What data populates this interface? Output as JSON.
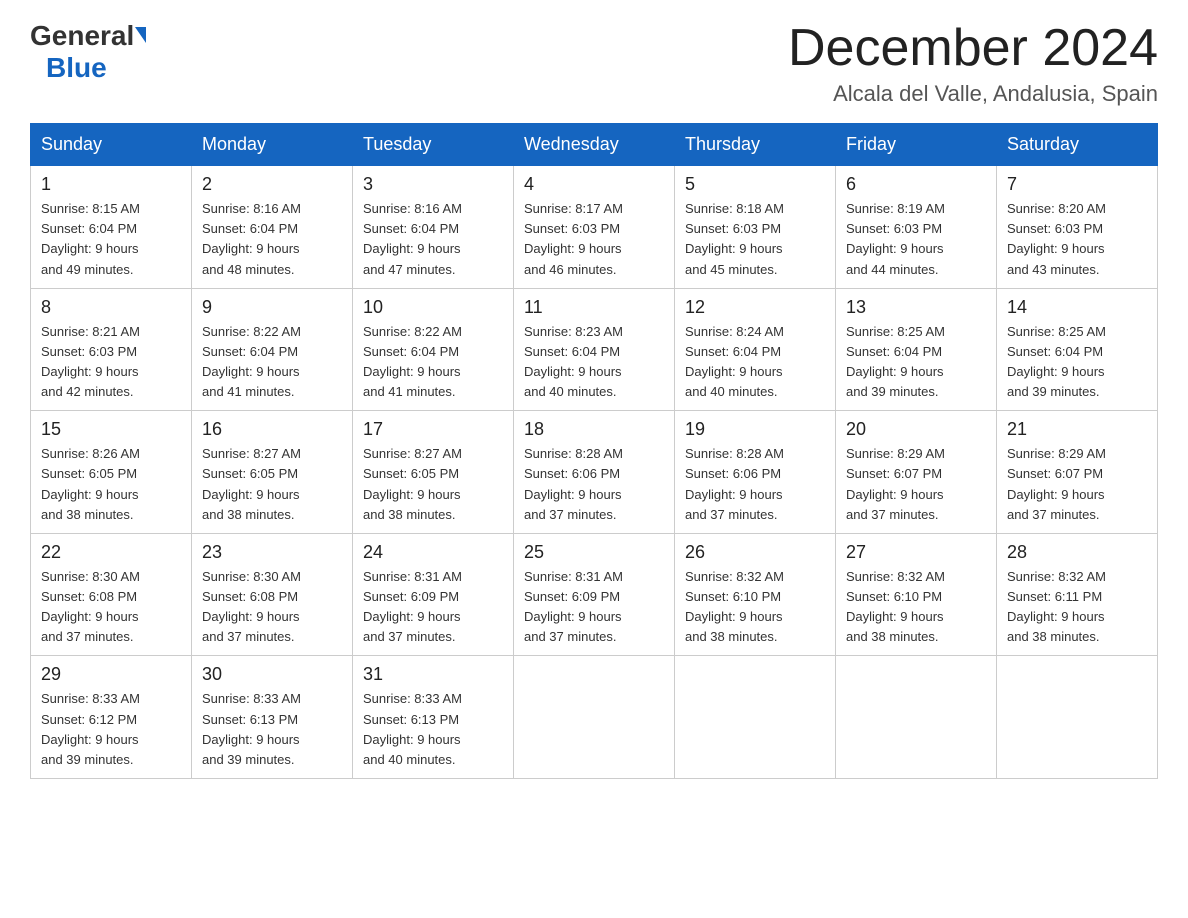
{
  "header": {
    "logo_general": "General",
    "logo_blue": "Blue",
    "month_year": "December 2024",
    "location": "Alcala del Valle, Andalusia, Spain"
  },
  "days_of_week": [
    "Sunday",
    "Monday",
    "Tuesday",
    "Wednesday",
    "Thursday",
    "Friday",
    "Saturday"
  ],
  "weeks": [
    [
      {
        "day": "1",
        "sunrise": "8:15 AM",
        "sunset": "6:04 PM",
        "daylight": "9 hours and 49 minutes."
      },
      {
        "day": "2",
        "sunrise": "8:16 AM",
        "sunset": "6:04 PM",
        "daylight": "9 hours and 48 minutes."
      },
      {
        "day": "3",
        "sunrise": "8:16 AM",
        "sunset": "6:04 PM",
        "daylight": "9 hours and 47 minutes."
      },
      {
        "day": "4",
        "sunrise": "8:17 AM",
        "sunset": "6:03 PM",
        "daylight": "9 hours and 46 minutes."
      },
      {
        "day": "5",
        "sunrise": "8:18 AM",
        "sunset": "6:03 PM",
        "daylight": "9 hours and 45 minutes."
      },
      {
        "day": "6",
        "sunrise": "8:19 AM",
        "sunset": "6:03 PM",
        "daylight": "9 hours and 44 minutes."
      },
      {
        "day": "7",
        "sunrise": "8:20 AM",
        "sunset": "6:03 PM",
        "daylight": "9 hours and 43 minutes."
      }
    ],
    [
      {
        "day": "8",
        "sunrise": "8:21 AM",
        "sunset": "6:03 PM",
        "daylight": "9 hours and 42 minutes."
      },
      {
        "day": "9",
        "sunrise": "8:22 AM",
        "sunset": "6:04 PM",
        "daylight": "9 hours and 41 minutes."
      },
      {
        "day": "10",
        "sunrise": "8:22 AM",
        "sunset": "6:04 PM",
        "daylight": "9 hours and 41 minutes."
      },
      {
        "day": "11",
        "sunrise": "8:23 AM",
        "sunset": "6:04 PM",
        "daylight": "9 hours and 40 minutes."
      },
      {
        "day": "12",
        "sunrise": "8:24 AM",
        "sunset": "6:04 PM",
        "daylight": "9 hours and 40 minutes."
      },
      {
        "day": "13",
        "sunrise": "8:25 AM",
        "sunset": "6:04 PM",
        "daylight": "9 hours and 39 minutes."
      },
      {
        "day": "14",
        "sunrise": "8:25 AM",
        "sunset": "6:04 PM",
        "daylight": "9 hours and 39 minutes."
      }
    ],
    [
      {
        "day": "15",
        "sunrise": "8:26 AM",
        "sunset": "6:05 PM",
        "daylight": "9 hours and 38 minutes."
      },
      {
        "day": "16",
        "sunrise": "8:27 AM",
        "sunset": "6:05 PM",
        "daylight": "9 hours and 38 minutes."
      },
      {
        "day": "17",
        "sunrise": "8:27 AM",
        "sunset": "6:05 PM",
        "daylight": "9 hours and 38 minutes."
      },
      {
        "day": "18",
        "sunrise": "8:28 AM",
        "sunset": "6:06 PM",
        "daylight": "9 hours and 37 minutes."
      },
      {
        "day": "19",
        "sunrise": "8:28 AM",
        "sunset": "6:06 PM",
        "daylight": "9 hours and 37 minutes."
      },
      {
        "day": "20",
        "sunrise": "8:29 AM",
        "sunset": "6:07 PM",
        "daylight": "9 hours and 37 minutes."
      },
      {
        "day": "21",
        "sunrise": "8:29 AM",
        "sunset": "6:07 PM",
        "daylight": "9 hours and 37 minutes."
      }
    ],
    [
      {
        "day": "22",
        "sunrise": "8:30 AM",
        "sunset": "6:08 PM",
        "daylight": "9 hours and 37 minutes."
      },
      {
        "day": "23",
        "sunrise": "8:30 AM",
        "sunset": "6:08 PM",
        "daylight": "9 hours and 37 minutes."
      },
      {
        "day": "24",
        "sunrise": "8:31 AM",
        "sunset": "6:09 PM",
        "daylight": "9 hours and 37 minutes."
      },
      {
        "day": "25",
        "sunrise": "8:31 AM",
        "sunset": "6:09 PM",
        "daylight": "9 hours and 37 minutes."
      },
      {
        "day": "26",
        "sunrise": "8:32 AM",
        "sunset": "6:10 PM",
        "daylight": "9 hours and 38 minutes."
      },
      {
        "day": "27",
        "sunrise": "8:32 AM",
        "sunset": "6:10 PM",
        "daylight": "9 hours and 38 minutes."
      },
      {
        "day": "28",
        "sunrise": "8:32 AM",
        "sunset": "6:11 PM",
        "daylight": "9 hours and 38 minutes."
      }
    ],
    [
      {
        "day": "29",
        "sunrise": "8:33 AM",
        "sunset": "6:12 PM",
        "daylight": "9 hours and 39 minutes."
      },
      {
        "day": "30",
        "sunrise": "8:33 AM",
        "sunset": "6:13 PM",
        "daylight": "9 hours and 39 minutes."
      },
      {
        "day": "31",
        "sunrise": "8:33 AM",
        "sunset": "6:13 PM",
        "daylight": "9 hours and 40 minutes."
      },
      null,
      null,
      null,
      null
    ]
  ],
  "labels": {
    "sunrise": "Sunrise:",
    "sunset": "Sunset:",
    "daylight": "Daylight:"
  }
}
